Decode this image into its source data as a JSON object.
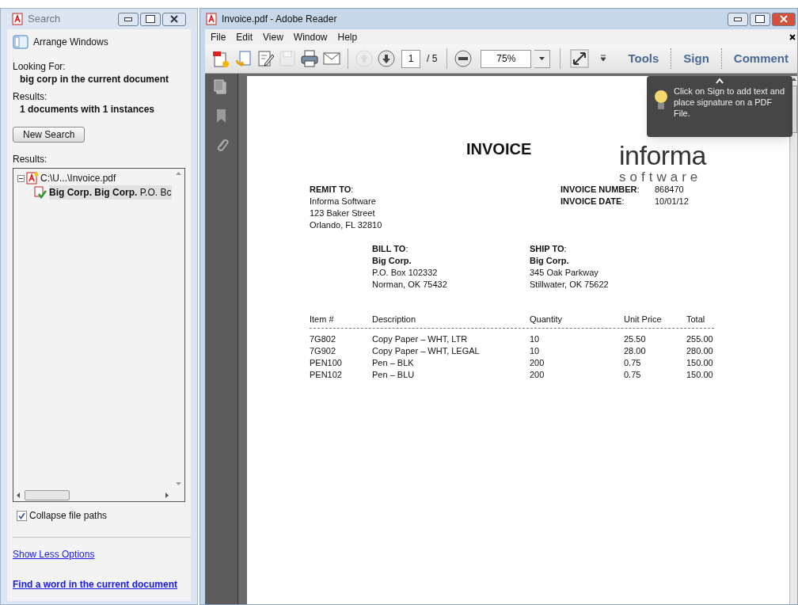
{
  "search_window": {
    "title": "Search",
    "arrange_windows": "Arrange Windows",
    "looking_for_label": "Looking For:",
    "looking_for_value": "big corp in the current document",
    "results_label": "Results:",
    "results_value": "1 documents with 1 instances",
    "new_search_button": "New Search",
    "results_list_label": "Results:",
    "results_tree": [
      {
        "label": "C:\\U...\\Invoice.pdf",
        "expanded": true,
        "children": [
          {
            "label": "**Big Corp. Big Corp.** P.O. Bc",
            "selected": true
          }
        ]
      }
    ],
    "collapse_file_paths": {
      "label": "Collapse file paths",
      "checked": true
    },
    "links": [
      "Show Less Options",
      "**Find a word in the current document**"
    ]
  },
  "reader_window": {
    "title": "Invoice.pdf - Adobe Reader",
    "menu": [
      "File",
      "Edit",
      "View",
      "Window",
      "Help"
    ],
    "toolbar": {
      "buttons": [
        {
          "kind": "create",
          "disabled": false
        },
        {
          "kind": "open",
          "disabled": false
        },
        {
          "kind": "edit",
          "disabled": false
        },
        {
          "kind": "save",
          "disabled": true
        },
        {
          "kind": "print",
          "disabled": false
        },
        {
          "kind": "email",
          "disabled": false
        },
        {
          "kind": "prev",
          "disabled": true
        },
        {
          "kind": "next",
          "disabled": false
        }
      ],
      "page_number": "1",
      "page_total": "/ 5",
      "zoom": "75%",
      "panes": [
        "Tools",
        "Sign",
        "Comment"
      ]
    },
    "tooltip": "Click on Sign to add text and place signature on a PDF File.",
    "document": {
      "heading": "INVOICE",
      "logo": [
        "informa",
        "software"
      ],
      "remit_to": {
        "label": "**REMIT TO**:",
        "lines": [
          "Informa Software",
          "123 Baker Street",
          "Orlando, FL  32810"
        ]
      },
      "invoice_fields": [
        {
          "label": "**INVOICE NUMBER**:",
          "value": "868470"
        },
        {
          "label": "**INVOICE DATE**:",
          "value": "10/01/12"
        }
      ],
      "bill_to": {
        "label": "**BILL TO**:",
        "name": "Big Corp.",
        "lines": [
          "P.O. Box 102332",
          "Norman, OK  75432"
        ]
      },
      "ship_to": {
        "label": "**SHIP TO**:",
        "name": "Big Corp.",
        "lines": [
          "345 Oak Parkway",
          "Stillwater, OK  75622"
        ]
      },
      "table": {
        "columns": [
          "Item #",
          "Description",
          "Quantity",
          "Unit Price",
          "Total"
        ],
        "rows": [
          [
            "7G802",
            "Copy Paper – WHT, LTR",
            "10",
            "25.50",
            "255.00"
          ],
          [
            "7G902",
            "Copy Paper – WHT, LEGAL",
            "10",
            "28.00",
            "280.00"
          ],
          [
            "PEN100",
            "Pen – BLK",
            "200",
            "0.75",
            "150.00"
          ],
          [
            "PEN102",
            "Pen – BLU",
            "200",
            "0.75",
            "150.00"
          ]
        ]
      }
    }
  }
}
